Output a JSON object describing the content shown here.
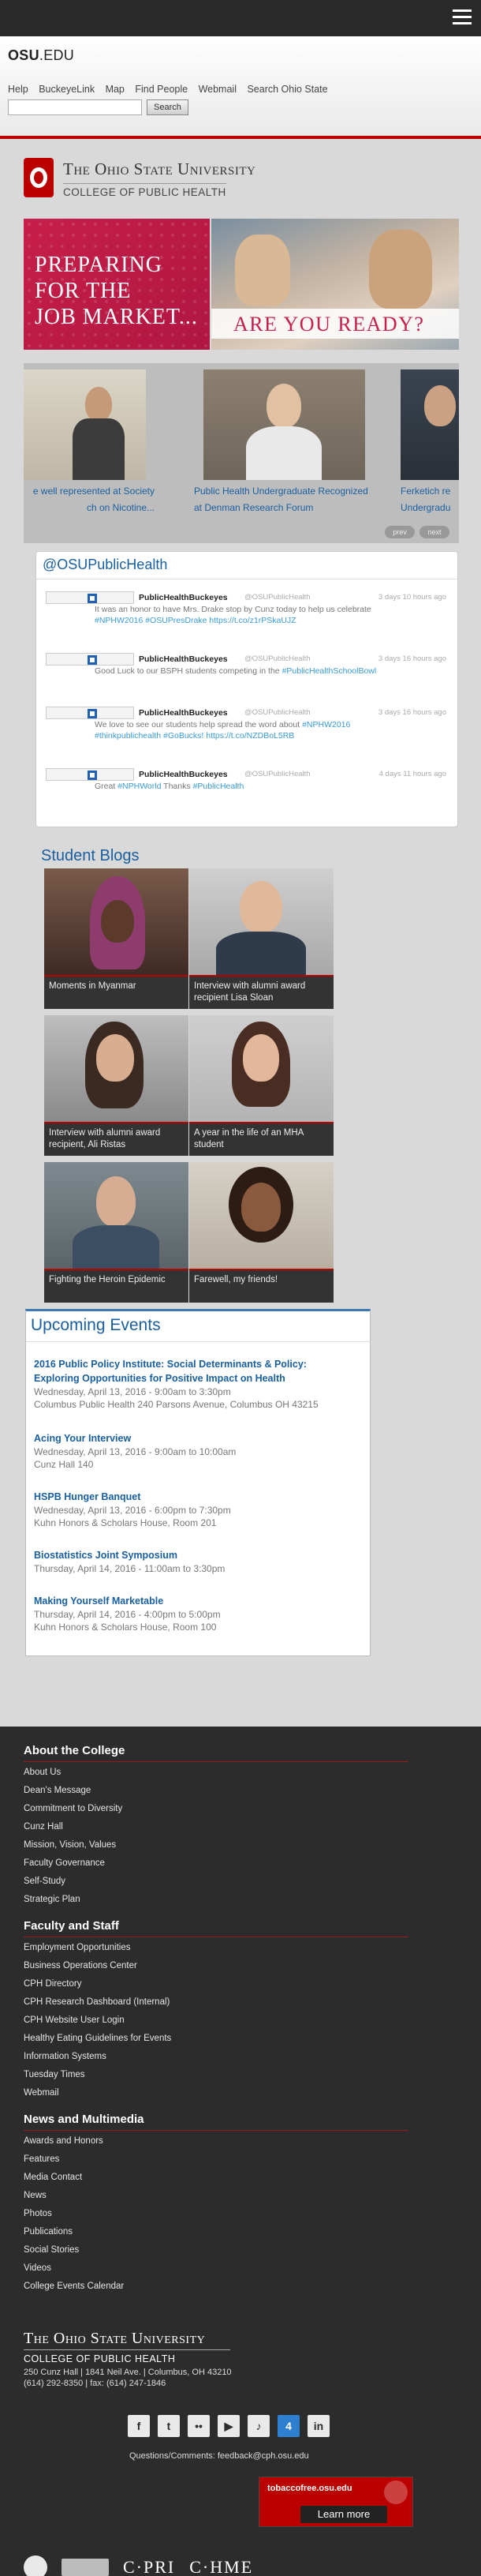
{
  "osu_bar": {
    "brand_bold": "OSU",
    "brand_rest": ".EDU",
    "links": [
      "Help",
      "BuckeyeLink",
      "Map",
      "Find People",
      "Webmail",
      "Search Ohio State"
    ],
    "search_placeholder": "",
    "search_button": "Search"
  },
  "header": {
    "university": "The Ohio State University",
    "college": "COLLEGE OF PUBLIC HEALTH"
  },
  "hero": {
    "left_text": [
      "PREPARING",
      "FOR THE",
      "JOB MARKET..."
    ],
    "right_text": "ARE YOU READY?"
  },
  "carousel": {
    "slides": [
      {
        "caption_lines": [
          "e well represented at Society",
          "ch on Nicotine..."
        ]
      },
      {
        "caption_lines": [
          "Public Health Undergraduate Recognized",
          "at Denman Research Forum"
        ]
      },
      {
        "caption_lines": [
          "Ferketich re",
          "Undergradu"
        ]
      }
    ],
    "prev_label": "prev",
    "next_label": "next"
  },
  "twitter": {
    "title": "@OSUPublicHealth",
    "tweets": [
      {
        "name": "PublicHealthBuckeyes",
        "handle": "@OSUPublicHealth",
        "time": "3 days 10 hours ago",
        "text": "It was an honor to have Mrs. Drake stop by Cunz today to help us celebrate",
        "links": "#NPHW2016 #OSUPresDrake https://t.co/z1rPSkaUJZ"
      },
      {
        "name": "PublicHealthBuckeyes",
        "handle": "@OSUPublicHealth",
        "time": "3 days 16 hours ago",
        "text": "Good Luck to our BSPH students competing in the ",
        "links": "#PublicHealthSchoolBowl"
      },
      {
        "name": "PublicHealthBuckeyes",
        "handle": "@OSUPublicHealth",
        "time": "3 days 16 hours ago",
        "text": "We love to see our students help spread the word about ",
        "links": "#NPHW2016"
      },
      {
        "name": "PublicHealthBuckeyes",
        "handle": "@OSUPublicHealth",
        "time": "4 days 11 hours ago",
        "text": "Great ",
        "links": "#NPHWorld"
      }
    ],
    "tweet3_line2": "#thinkpublichealth #GoBucks! https://t.co/NZDBoL5RB",
    "tweet4_rest": " Thanks ",
    "tweet4_tag": "#PublicHealth"
  },
  "blogs": {
    "title": "Student Blogs",
    "items": [
      {
        "caption": "Moments in Myanmar"
      },
      {
        "caption": "Interview with alumni award recipient Lisa Sloan"
      },
      {
        "caption": "Interview with alumni award recipient, Ali Ristas"
      },
      {
        "caption": "A year in the life of an MHA student"
      },
      {
        "caption": "Fighting the Heroin Epidemic"
      },
      {
        "caption": "Farewell, my friends!"
      }
    ]
  },
  "events": {
    "title": "Upcoming Events",
    "items": [
      {
        "title_lines": [
          "2016 Public Policy Institute: Social Determinants & Policy:",
          "Exploring Opportunities for Positive Impact on Health"
        ],
        "when": "Wednesday, April 13, 2016 - 9:00am to 3:30pm",
        "where": "Columbus Public Health 240 Parsons Avenue, Columbus OH 43215"
      },
      {
        "title_lines": [
          "Acing Your Interview"
        ],
        "when": "Wednesday, April 13, 2016 - 9:00am to 10:00am",
        "where": "Cunz Hall 140"
      },
      {
        "title_lines": [
          "HSPB Hunger Banquet"
        ],
        "when": "Wednesday, April 13, 2016 - 6:00pm to 7:30pm",
        "where": "Kuhn Honors & Scholars House, Room 201"
      },
      {
        "title_lines": [
          "Biostatistics Joint Symposium"
        ],
        "when": "Thursday, April 14, 2016 - 11:00am to 3:30pm",
        "where": ""
      },
      {
        "title_lines": [
          "Making Yourself Marketable"
        ],
        "when": "Thursday, April 14, 2016 - 4:00pm to 5:00pm",
        "where": "Kuhn Honors & Scholars House, Room 100"
      }
    ]
  },
  "footer": {
    "sections": [
      {
        "title": "About the College",
        "links": [
          "About Us",
          "Dean's Message",
          "Commitment to Diversity",
          "Cunz Hall",
          "Mission, Vision, Values",
          "Faculty Governance",
          "Self-Study",
          "Strategic Plan"
        ]
      },
      {
        "title": "Faculty and Staff",
        "links": [
          "Employment Opportunities",
          "Business Operations Center",
          "CPH Directory",
          "CPH Research Dashboard (Internal)",
          "CPH Website User Login",
          "Healthy Eating Guidelines for Events",
          "Information Systems",
          "Tuesday Times",
          "Webmail"
        ]
      },
      {
        "title": "News and Multimedia",
        "links": [
          "Awards and Honors",
          "Features",
          "Media Contact",
          "News",
          "Photos",
          "Publications",
          "Social Stories",
          "Videos",
          "College Events Calendar"
        ]
      }
    ],
    "university": "The Ohio State University",
    "college": "COLLEGE OF PUBLIC HEALTH",
    "address": "250 Cunz Hall | 1841 Neil Ave. | Columbus, OH 43210",
    "phone": "(614) 292-8350 | fax: (614) 247-1846",
    "social_icons": [
      "facebook-icon",
      "twitter-icon",
      "flickr-icon",
      "youtube-icon",
      "podcast-icon",
      "foursquare-icon",
      "linkedin-icon"
    ],
    "contact": "Questions/Comments: feedback@cph.osu.edu",
    "tobacco_site": "tobaccofree.osu.edu",
    "learn_more": "Learn more",
    "partner_logos": [
      "C·PRI",
      "C·HME"
    ]
  }
}
